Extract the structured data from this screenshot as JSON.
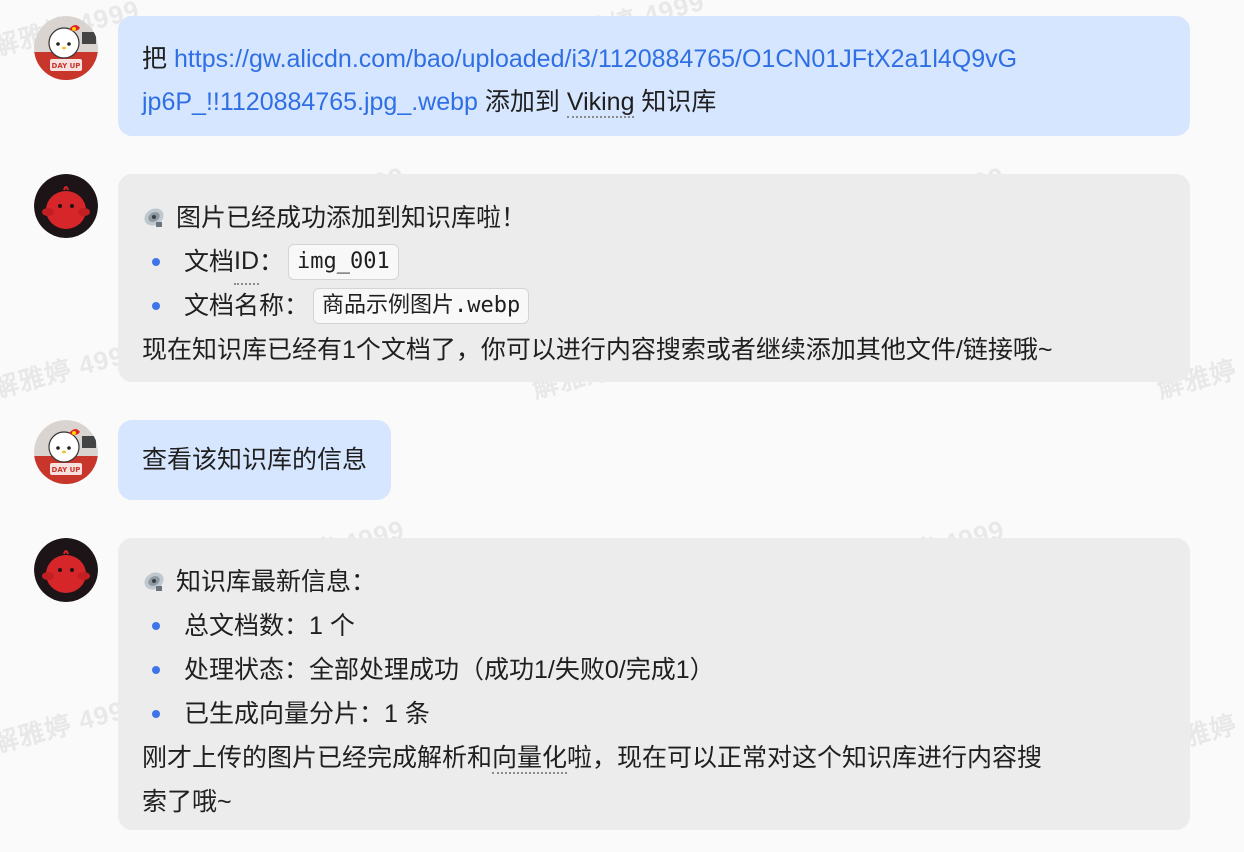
{
  "watermark_text": "解雅婷 4999",
  "messages": [
    {
      "role": "user",
      "prefix": "把 ",
      "link": "https://gw.alicdn.com/bao/uploaded/i3/1120884765/O1CN01JFtX2a1l4Q9vGjp6P_!!1120884765.jpg_.webp",
      "link_line1": "https://gw.alicdn.com/bao/uploaded/i3/1120884765/O1CN01JFtX2a1l4Q9vG",
      "link_line2": "jp6P_!!1120884765.jpg_.webp",
      "middle": " 添加到 ",
      "kb_name": "Viking",
      "suffix": " 知识库"
    },
    {
      "role": "assistant",
      "icon": "satellite-dish-icon",
      "heading": "图片已经成功添加到知识库啦！",
      "items": [
        {
          "label_main": "文档",
          "label_term": "ID",
          "label_sep": "：",
          "code": "img_001"
        },
        {
          "label_main": "文档名称：",
          "code_main": "商品示例图片",
          "code_ext": ".webp"
        }
      ],
      "footer": "现在知识库已经有1个文档了，你可以进行内容搜索或者继续添加其他文件/链接哦~"
    },
    {
      "role": "user",
      "text": "查看该知识库的信息"
    },
    {
      "role": "assistant",
      "icon": "satellite-dish-icon",
      "heading": "知识库最新信息：",
      "items": [
        "总文档数：1 个",
        "处理状态：全部处理成功（成功1/失败0/完成1）",
        "已生成向量分片：1 条"
      ],
      "footer_line1_a": "刚才上传的图片已经完成解析和",
      "footer_line1_term": "向量化",
      "footer_line1_b": "啦，现在可以正常对这个知识库进行内容搜",
      "footer_line2": "索了哦~"
    }
  ],
  "colors": {
    "user_bubble": "#d6e6ff",
    "bot_bubble": "#ececec",
    "link": "#2f6fe4",
    "bullet": "#3f74e8"
  }
}
